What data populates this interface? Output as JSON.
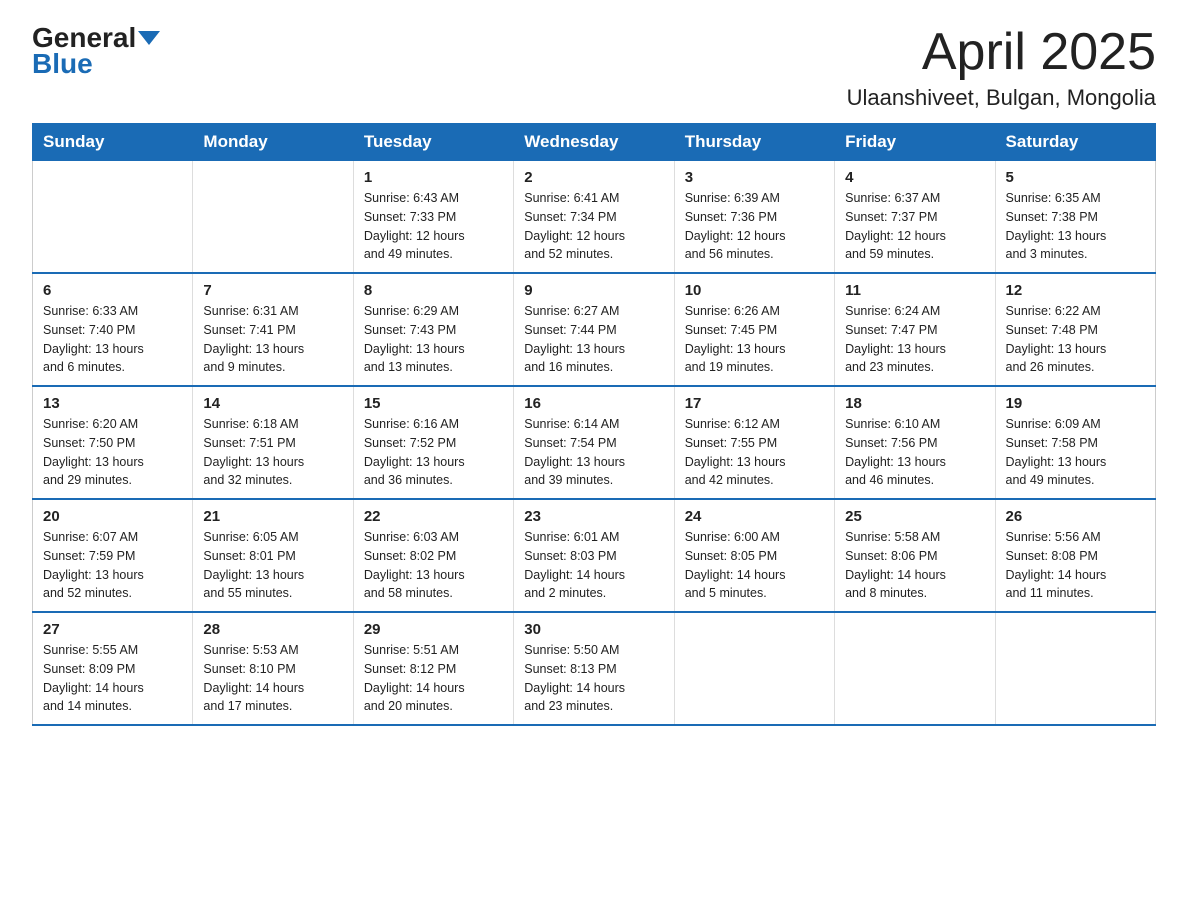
{
  "header": {
    "logo_text1": "General",
    "logo_text2": "Blue",
    "month_title": "April 2025",
    "location": "Ulaanshiveet, Bulgan, Mongolia"
  },
  "days_of_week": [
    "Sunday",
    "Monday",
    "Tuesday",
    "Wednesday",
    "Thursday",
    "Friday",
    "Saturday"
  ],
  "weeks": [
    [
      {
        "day": "",
        "info": ""
      },
      {
        "day": "",
        "info": ""
      },
      {
        "day": "1",
        "info": "Sunrise: 6:43 AM\nSunset: 7:33 PM\nDaylight: 12 hours\nand 49 minutes."
      },
      {
        "day": "2",
        "info": "Sunrise: 6:41 AM\nSunset: 7:34 PM\nDaylight: 12 hours\nand 52 minutes."
      },
      {
        "day": "3",
        "info": "Sunrise: 6:39 AM\nSunset: 7:36 PM\nDaylight: 12 hours\nand 56 minutes."
      },
      {
        "day": "4",
        "info": "Sunrise: 6:37 AM\nSunset: 7:37 PM\nDaylight: 12 hours\nand 59 minutes."
      },
      {
        "day": "5",
        "info": "Sunrise: 6:35 AM\nSunset: 7:38 PM\nDaylight: 13 hours\nand 3 minutes."
      }
    ],
    [
      {
        "day": "6",
        "info": "Sunrise: 6:33 AM\nSunset: 7:40 PM\nDaylight: 13 hours\nand 6 minutes."
      },
      {
        "day": "7",
        "info": "Sunrise: 6:31 AM\nSunset: 7:41 PM\nDaylight: 13 hours\nand 9 minutes."
      },
      {
        "day": "8",
        "info": "Sunrise: 6:29 AM\nSunset: 7:43 PM\nDaylight: 13 hours\nand 13 minutes."
      },
      {
        "day": "9",
        "info": "Sunrise: 6:27 AM\nSunset: 7:44 PM\nDaylight: 13 hours\nand 16 minutes."
      },
      {
        "day": "10",
        "info": "Sunrise: 6:26 AM\nSunset: 7:45 PM\nDaylight: 13 hours\nand 19 minutes."
      },
      {
        "day": "11",
        "info": "Sunrise: 6:24 AM\nSunset: 7:47 PM\nDaylight: 13 hours\nand 23 minutes."
      },
      {
        "day": "12",
        "info": "Sunrise: 6:22 AM\nSunset: 7:48 PM\nDaylight: 13 hours\nand 26 minutes."
      }
    ],
    [
      {
        "day": "13",
        "info": "Sunrise: 6:20 AM\nSunset: 7:50 PM\nDaylight: 13 hours\nand 29 minutes."
      },
      {
        "day": "14",
        "info": "Sunrise: 6:18 AM\nSunset: 7:51 PM\nDaylight: 13 hours\nand 32 minutes."
      },
      {
        "day": "15",
        "info": "Sunrise: 6:16 AM\nSunset: 7:52 PM\nDaylight: 13 hours\nand 36 minutes."
      },
      {
        "day": "16",
        "info": "Sunrise: 6:14 AM\nSunset: 7:54 PM\nDaylight: 13 hours\nand 39 minutes."
      },
      {
        "day": "17",
        "info": "Sunrise: 6:12 AM\nSunset: 7:55 PM\nDaylight: 13 hours\nand 42 minutes."
      },
      {
        "day": "18",
        "info": "Sunrise: 6:10 AM\nSunset: 7:56 PM\nDaylight: 13 hours\nand 46 minutes."
      },
      {
        "day": "19",
        "info": "Sunrise: 6:09 AM\nSunset: 7:58 PM\nDaylight: 13 hours\nand 49 minutes."
      }
    ],
    [
      {
        "day": "20",
        "info": "Sunrise: 6:07 AM\nSunset: 7:59 PM\nDaylight: 13 hours\nand 52 minutes."
      },
      {
        "day": "21",
        "info": "Sunrise: 6:05 AM\nSunset: 8:01 PM\nDaylight: 13 hours\nand 55 minutes."
      },
      {
        "day": "22",
        "info": "Sunrise: 6:03 AM\nSunset: 8:02 PM\nDaylight: 13 hours\nand 58 minutes."
      },
      {
        "day": "23",
        "info": "Sunrise: 6:01 AM\nSunset: 8:03 PM\nDaylight: 14 hours\nand 2 minutes."
      },
      {
        "day": "24",
        "info": "Sunrise: 6:00 AM\nSunset: 8:05 PM\nDaylight: 14 hours\nand 5 minutes."
      },
      {
        "day": "25",
        "info": "Sunrise: 5:58 AM\nSunset: 8:06 PM\nDaylight: 14 hours\nand 8 minutes."
      },
      {
        "day": "26",
        "info": "Sunrise: 5:56 AM\nSunset: 8:08 PM\nDaylight: 14 hours\nand 11 minutes."
      }
    ],
    [
      {
        "day": "27",
        "info": "Sunrise: 5:55 AM\nSunset: 8:09 PM\nDaylight: 14 hours\nand 14 minutes."
      },
      {
        "day": "28",
        "info": "Sunrise: 5:53 AM\nSunset: 8:10 PM\nDaylight: 14 hours\nand 17 minutes."
      },
      {
        "day": "29",
        "info": "Sunrise: 5:51 AM\nSunset: 8:12 PM\nDaylight: 14 hours\nand 20 minutes."
      },
      {
        "day": "30",
        "info": "Sunrise: 5:50 AM\nSunset: 8:13 PM\nDaylight: 14 hours\nand 23 minutes."
      },
      {
        "day": "",
        "info": ""
      },
      {
        "day": "",
        "info": ""
      },
      {
        "day": "",
        "info": ""
      }
    ]
  ]
}
